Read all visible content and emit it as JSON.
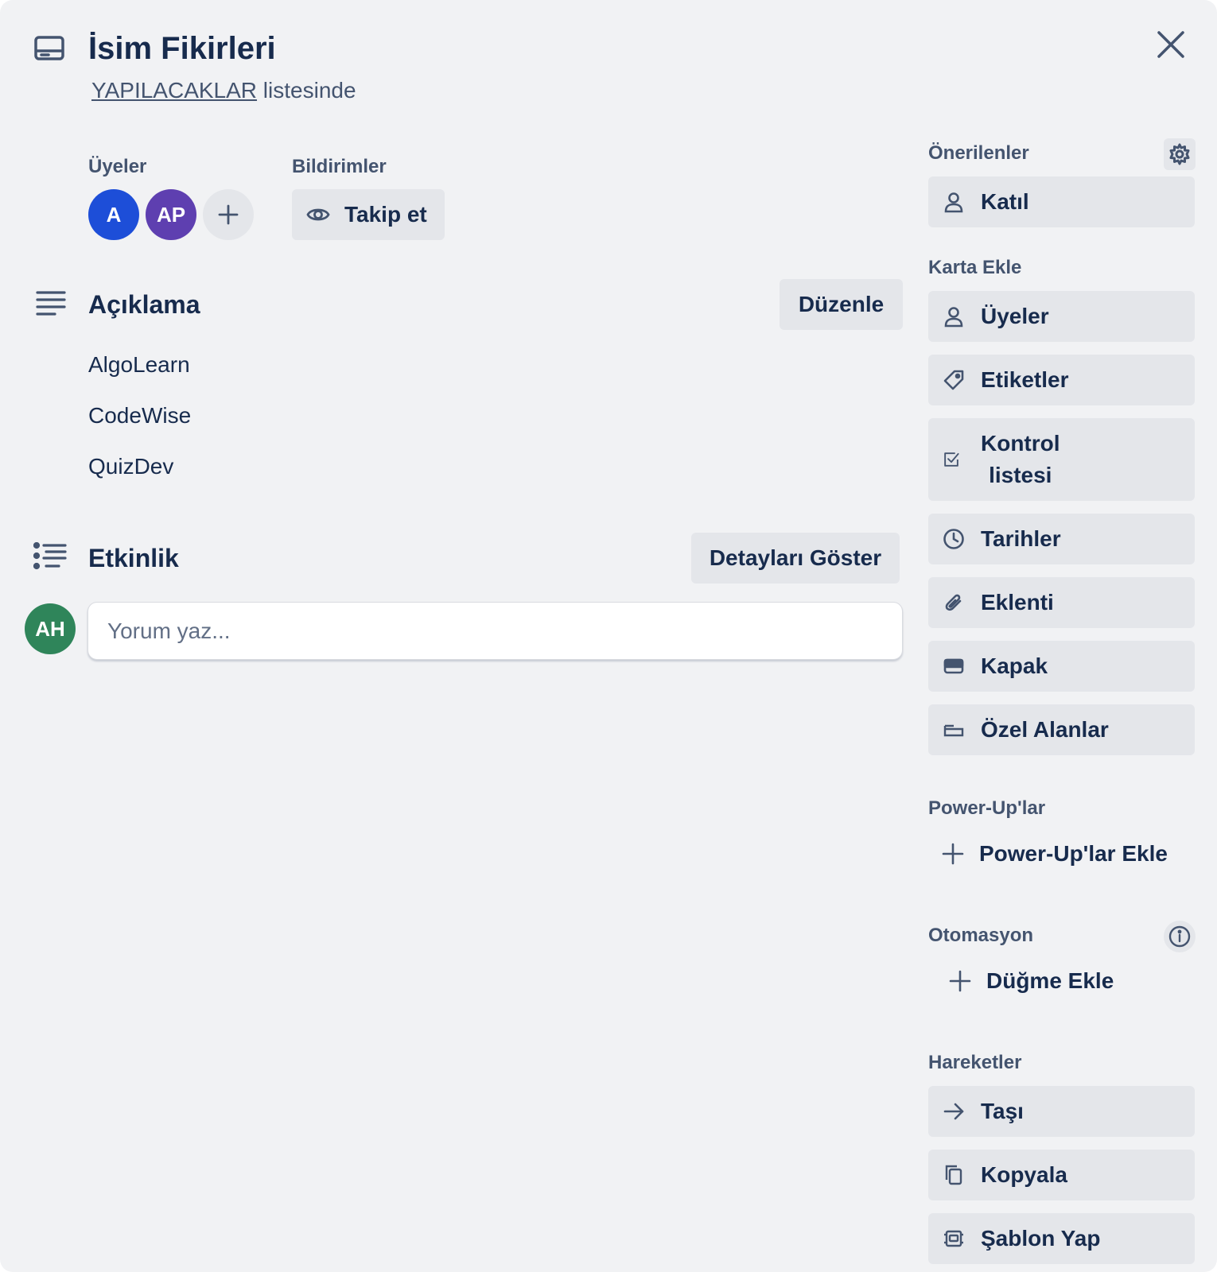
{
  "card": {
    "title": "İsim Fikirleri",
    "list_name": "YAPILACAKLAR",
    "list_suffix": " listesinde"
  },
  "members": {
    "label": "Üyeler",
    "avatars": [
      {
        "initials": "A",
        "color": "#1d4ed8"
      },
      {
        "initials": "AP",
        "color": "#5e3fb0"
      }
    ],
    "add_icon": "plus-icon"
  },
  "notifications": {
    "label": "Bildirimler",
    "watch_label": "Takip et"
  },
  "description": {
    "title": "Açıklama",
    "edit_label": "Düzenle",
    "lines": [
      "AlgoLearn",
      "CodeWise",
      "QuizDev"
    ]
  },
  "activity": {
    "title": "Etkinlik",
    "details_label": "Detayları Göster",
    "user_initials": "AH",
    "user_color": "#2f855a",
    "comment_placeholder": "Yorum yaz..."
  },
  "sidebar": {
    "suggested": {
      "label": "Önerilenler",
      "join_label": "Katıl"
    },
    "add_to_card": {
      "label": "Karta Ekle",
      "items": [
        {
          "label": "Üyeler",
          "icon": "person-icon"
        },
        {
          "label": "Etiketler",
          "icon": "tag-icon"
        },
        {
          "label_line1": "Kontrol",
          "label_line2": "listesi",
          "icon": "checklist-icon"
        },
        {
          "label": "Tarihler",
          "icon": "clock-icon"
        },
        {
          "label": "Eklenti",
          "icon": "paperclip-icon"
        },
        {
          "label": "Kapak",
          "icon": "cover-icon"
        },
        {
          "label": "Özel Alanlar",
          "icon": "custom-fields-icon"
        }
      ]
    },
    "power_ups": {
      "label": "Power-Up'lar",
      "add_label": "Power-Up'lar Ekle"
    },
    "automation": {
      "label": "Otomasyon",
      "add_button_label": "Düğme Ekle"
    },
    "actions": {
      "label": "Hareketler",
      "items": [
        {
          "label": "Taşı",
          "icon": "arrow-right-icon"
        },
        {
          "label": "Kopyala",
          "icon": "copy-icon"
        },
        {
          "label": "Şablon Yap",
          "icon": "template-icon"
        }
      ]
    }
  }
}
